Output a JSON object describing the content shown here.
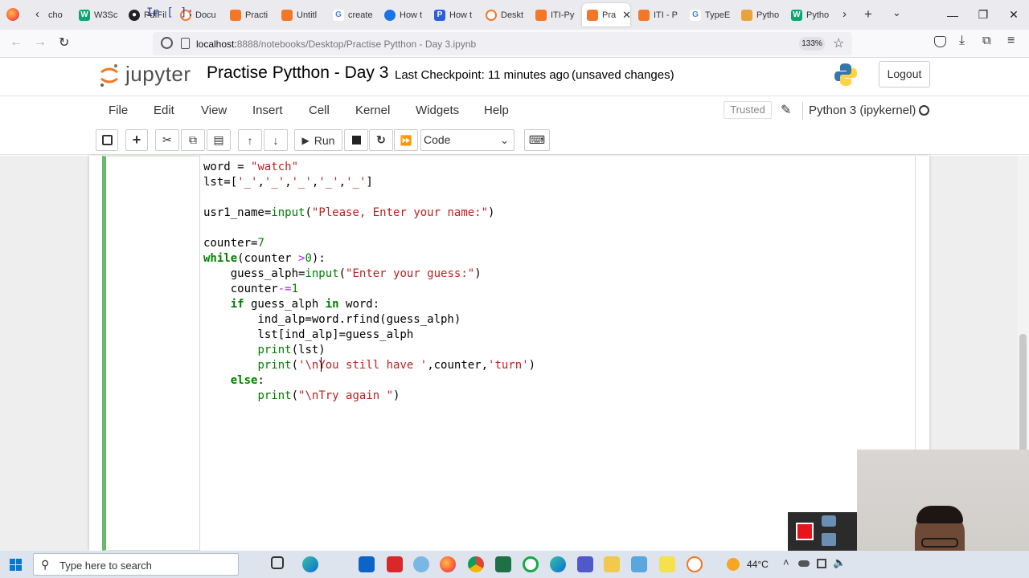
{
  "browser": {
    "tabs": [
      {
        "label": "cho",
        "icon": "globe"
      },
      {
        "label": "W3Sc",
        "icon": "w3schools"
      },
      {
        "label": "PdfFil",
        "icon": "github"
      },
      {
        "label": "Docu",
        "icon": "jupyter"
      },
      {
        "label": "Practi",
        "icon": "jupyter-notebook"
      },
      {
        "label": "Untitl",
        "icon": "jupyter-notebook"
      },
      {
        "label": "create",
        "icon": "google"
      },
      {
        "label": "How t",
        "icon": "browser"
      },
      {
        "label": "How t",
        "icon": "p-site"
      },
      {
        "label": "Deskt",
        "icon": "jupyter"
      },
      {
        "label": "ITI-Py",
        "icon": "jupyter-notebook"
      },
      {
        "label": "Pra",
        "icon": "jupyter-notebook",
        "active": true
      },
      {
        "label": "ITI - P",
        "icon": "jupyter-notebook"
      },
      {
        "label": "TypeE",
        "icon": "google"
      },
      {
        "label": "Pytho",
        "icon": "python-docs"
      },
      {
        "label": "Pytho",
        "icon": "w3schools"
      }
    ],
    "url_host": "localhost:",
    "url_rest": "8888/notebooks/Desktop/Practise Pytthon - Day 3.ipynb",
    "zoom": "133%"
  },
  "jupyter": {
    "logo_text": "jupyter",
    "notebook_title": "Practise Pytthon - Day 3",
    "checkpoint": "Last Checkpoint: 11 minutes ago",
    "unsaved": "(unsaved changes)",
    "logout_label": "Logout",
    "menu": [
      "File",
      "Edit",
      "View",
      "Insert",
      "Cell",
      "Kernel",
      "Widgets",
      "Help"
    ],
    "trusted_label": "Trusted",
    "kernel_name": "Python 3 (ipykernel)",
    "run_label": "Run",
    "cell_type": "Code",
    "prompt": "In [ ]:"
  },
  "taskbar": {
    "search_placeholder": "Type here to search",
    "temperature": "44°C"
  },
  "colors": {
    "cell_border_active": "#66bb6a",
    "keyword": "#008000",
    "string": "#ba2121",
    "operator": "#aa22ff",
    "prompt": "#303f9f"
  }
}
